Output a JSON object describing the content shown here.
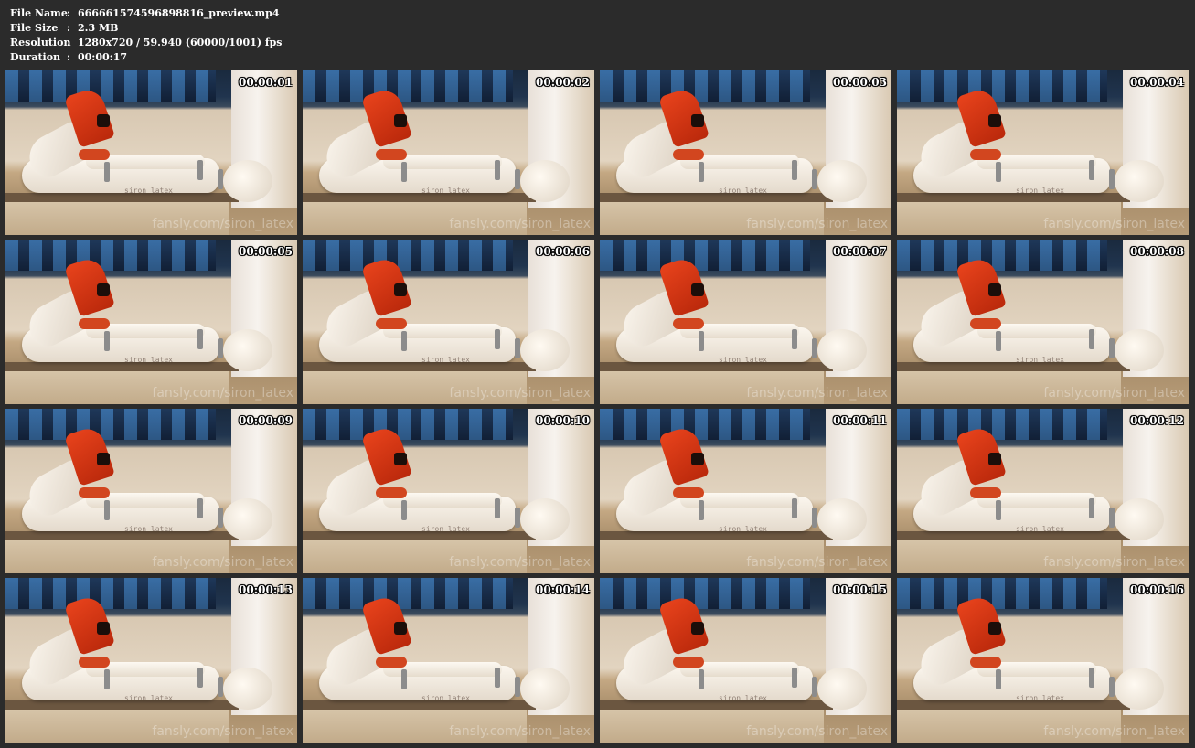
{
  "file_info": {
    "file_name_label": "File Name",
    "file_name_value": "666661574596898816_preview.mp4",
    "file_size_label": "File Size",
    "file_size_value": "2.3 MB",
    "resolution_label": "Resolution",
    "resolution_value": "1280x720 / 59.940 (60000/1001) fps",
    "duration_label": "Duration",
    "duration_value": "00:00:17",
    "separator": ":"
  },
  "thumbnails": [
    {
      "timestamp": "00:00:01",
      "watermark": "fansly.com/siron_latex",
      "mark": "siron_latex"
    },
    {
      "timestamp": "00:00:02",
      "watermark": "fansly.com/siron_latex",
      "mark": "siron_latex"
    },
    {
      "timestamp": "00:00:03",
      "watermark": "fansly.com/siron_latex",
      "mark": "siron_latex"
    },
    {
      "timestamp": "00:00:04",
      "watermark": "fansly.com/siron_latex",
      "mark": "siron_latex"
    },
    {
      "timestamp": "00:00:05",
      "watermark": "fansly.com/siron_latex",
      "mark": "siron_latex"
    },
    {
      "timestamp": "00:00:06",
      "watermark": "fansly.com/siron_latex",
      "mark": "siron_latex"
    },
    {
      "timestamp": "00:00:07",
      "watermark": "fansly.com/siron_latex",
      "mark": "siron_latex"
    },
    {
      "timestamp": "00:00:08",
      "watermark": "fansly.com/siron_latex",
      "mark": "siron_latex"
    },
    {
      "timestamp": "00:00:09",
      "watermark": "fansly.com/siron_latex",
      "mark": "siron_latex"
    },
    {
      "timestamp": "00:00:10",
      "watermark": "fansly.com/siron_latex",
      "mark": "siron_latex"
    },
    {
      "timestamp": "00:00:11",
      "watermark": "fansly.com/siron_latex",
      "mark": "siron_latex"
    },
    {
      "timestamp": "00:00:12",
      "watermark": "fansly.com/siron_latex",
      "mark": "siron_latex"
    },
    {
      "timestamp": "00:00:13",
      "watermark": "fansly.com/siron_latex",
      "mark": "siron_latex"
    },
    {
      "timestamp": "00:00:14",
      "watermark": "fansly.com/siron_latex",
      "mark": "siron_latex"
    },
    {
      "timestamp": "00:00:15",
      "watermark": "fansly.com/siron_latex",
      "mark": "siron_latex"
    },
    {
      "timestamp": "00:00:16",
      "watermark": "fansly.com/siron_latex",
      "mark": "siron_latex"
    }
  ]
}
